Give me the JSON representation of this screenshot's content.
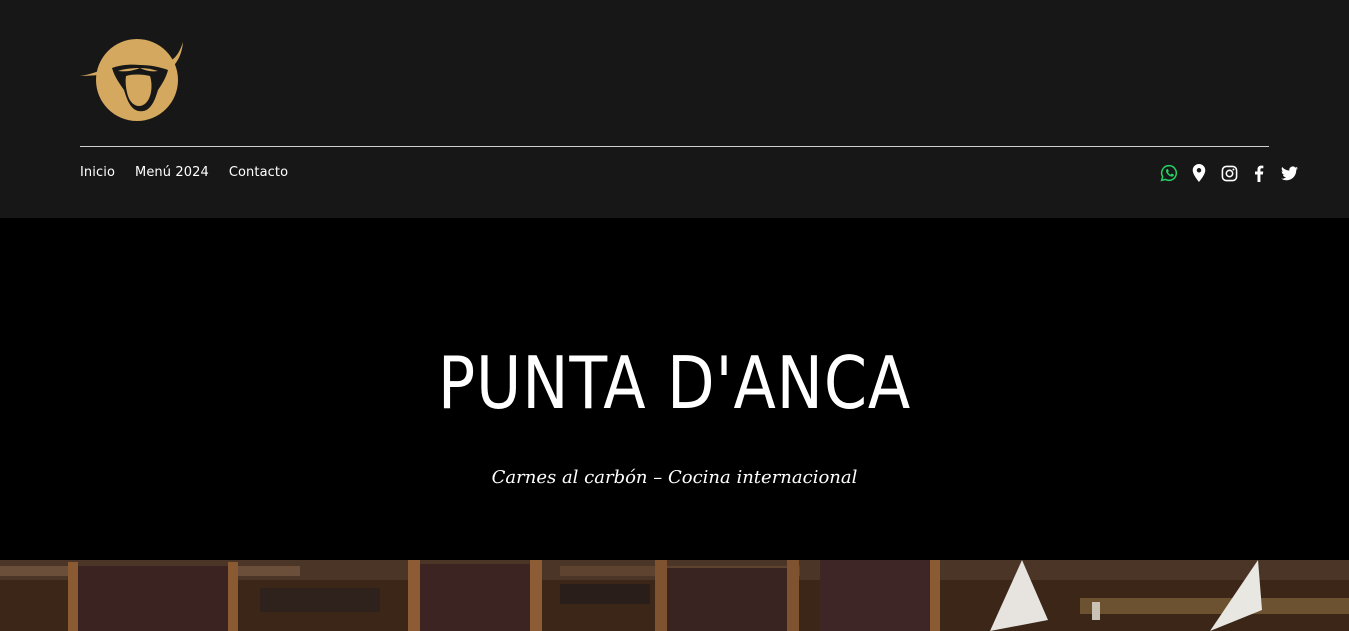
{
  "header": {
    "logo_name": "bull-head-logo",
    "logo_color": "#D4A85E"
  },
  "nav": {
    "items": [
      {
        "label": "Inicio"
      },
      {
        "label": "Menú 2024"
      },
      {
        "label": "Contacto"
      }
    ]
  },
  "social": {
    "items": [
      {
        "icon": "whatsapp-icon",
        "color": "#25D366"
      },
      {
        "icon": "map-pin-icon",
        "color": "#ffffff"
      },
      {
        "icon": "instagram-icon",
        "color": "#ffffff"
      },
      {
        "icon": "facebook-icon",
        "color": "#ffffff"
      },
      {
        "icon": "twitter-icon",
        "color": "#ffffff"
      }
    ]
  },
  "hero": {
    "title": "PUNTA D'ANCA",
    "subtitle": "Carnes al carbón – Cocina internacional"
  },
  "colors": {
    "header_bg": "#171717",
    "hero_bg": "#000000",
    "text": "#ffffff",
    "accent_gold": "#D4A85E"
  }
}
